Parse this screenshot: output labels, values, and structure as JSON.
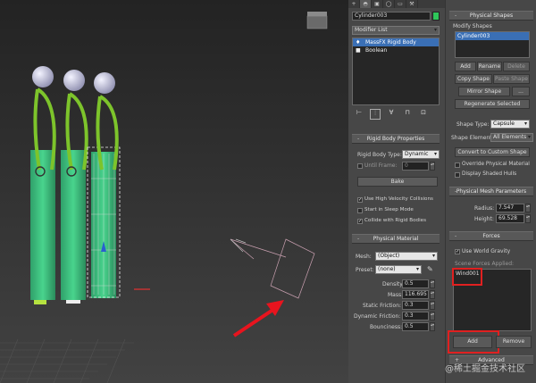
{
  "cmd_tabs": [
    "+",
    "◓",
    "▣",
    "◯",
    "▭",
    "⚒"
  ],
  "object_name": "Cylinder003",
  "object_color": "#2fc65a",
  "modifier_list_label": "Modifier List",
  "stack": [
    "MassFX Rigid Body",
    "Boolean"
  ],
  "stack_icons": [
    "⊢",
    "⫶",
    "∀",
    "⊓",
    "⊡"
  ],
  "rigid_body": {
    "title": "Rigid Body Properties",
    "type_label": "Rigid Body Type:",
    "type_value": "Dynamic",
    "until_frame_label": "Until Frame:",
    "until_frame_value": "0",
    "bake": "Bake",
    "options": [
      "Use High Velocity Collisions",
      "Start in Sleep Mode",
      "Collide with Rigid Bodies"
    ]
  },
  "physical_material": {
    "title": "Physical Material",
    "mesh_label": "Mesh:",
    "mesh_value": "(Object)",
    "preset_label": "Preset:",
    "preset_value": "(none)",
    "fields": [
      {
        "label": "Density:",
        "value": "0.5"
      },
      {
        "label": "Mass:",
        "value": "116.695"
      },
      {
        "label": "Static Friction:",
        "value": "0.3"
      },
      {
        "label": "Dynamic Friction:",
        "value": "0.3"
      },
      {
        "label": "Bounciness:",
        "value": "0.5"
      }
    ]
  },
  "physical_shapes": {
    "title": "Physical Shapes",
    "modify_label": "Modify Shapes",
    "selected_shape": "Cylinder003",
    "add": "Add",
    "rename": "Rename",
    "delete": "Delete",
    "copy": "Copy Shape",
    "paste": "Paste Shape",
    "mirror": "Mirror Shape",
    "more": "...",
    "regenerate": "Regenerate Selected",
    "shape_type_label": "Shape Type:",
    "shape_type_value": "Capsule",
    "shape_element_label": "Shape Element:",
    "shape_element_value": "All Elements",
    "convert": "Convert to Custom Shape",
    "override": "Override Physical Material",
    "display_hulls": "Display Shaded Hulls"
  },
  "mesh_params": {
    "title": "Physical Mesh Parameters",
    "radius_label": "Radius:",
    "radius_value": "7.547",
    "height_label": "Height:",
    "height_value": "69.528"
  },
  "forces": {
    "title": "Forces",
    "use_gravity": "Use World Gravity",
    "applied_label": "Scene Forces Applied:",
    "items": [
      "Wind001"
    ],
    "add": "Add",
    "remove": "Remove"
  },
  "advanced_title": "Advanced",
  "watermark": "@稀土掘金技术社区",
  "accent_colors": {
    "highlight": "#e02020",
    "selection": "#3a6fb5",
    "arrow": "#e8141e"
  }
}
